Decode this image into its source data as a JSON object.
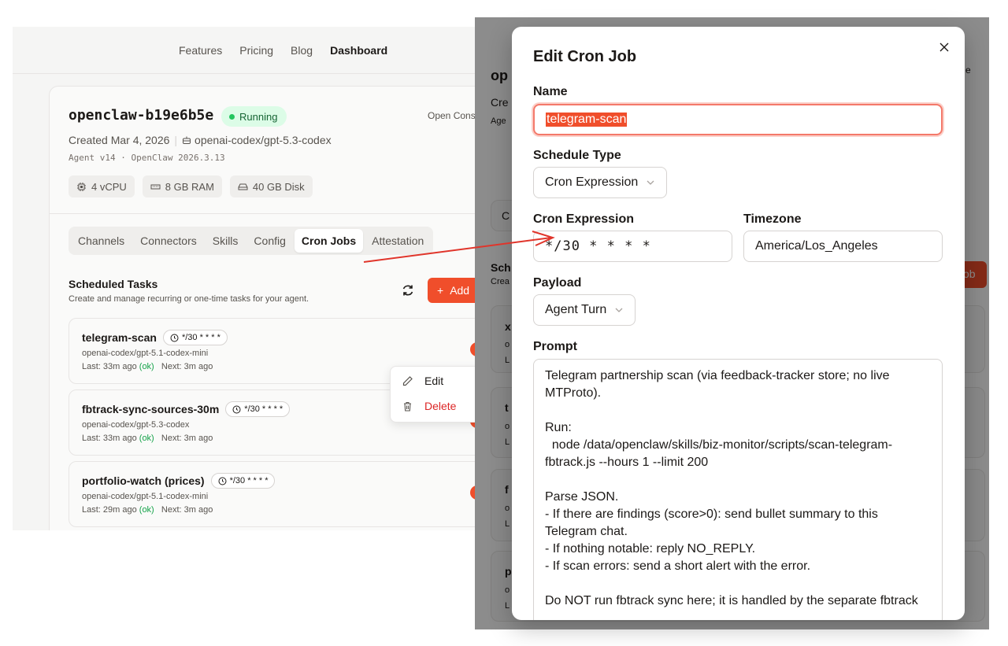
{
  "left": {
    "nav": [
      "Features",
      "Pricing",
      "Blog",
      "Dashboard"
    ],
    "nav_active_index": 3,
    "agent": {
      "name": "openclaw-b19e6b5e",
      "status": "Running",
      "open_console": "Open Cons",
      "created": "Created Mar 4, 2026",
      "model": "openai-codex/gpt-5.3-codex",
      "version": "Agent v14 · OpenClaw 2026.3.13",
      "specs": [
        "4 vCPU",
        "8 GB RAM",
        "40 GB Disk"
      ]
    },
    "tabs": [
      "Channels",
      "Connectors",
      "Skills",
      "Config",
      "Cron Jobs",
      "Attestation"
    ],
    "active_tab_index": 4,
    "scheduled": {
      "title": "Scheduled Tasks",
      "subtitle": "Create and manage recurring or one-time tasks for your agent.",
      "add_label": "Add"
    },
    "jobs": [
      {
        "name": "telegram-scan",
        "schedule": "*/30 * * * *",
        "model": "openai-codex/gpt-5.1-codex-mini",
        "last": "Last: 33m ago",
        "ok": "(ok)",
        "next": "Next: 3m ago",
        "enabled": true
      },
      {
        "name": "fbtrack-sync-sources-30m",
        "schedule": "*/30 * * * *",
        "model": "openai-codex/gpt-5.3-codex",
        "last": "Last: 33m ago",
        "ok": "(ok)",
        "next": "Next: 3m ago",
        "enabled": true
      },
      {
        "name": "portfolio-watch (prices)",
        "schedule": "*/30 * * * *",
        "model": "openai-codex/gpt-5.1-codex-mini",
        "last": "Last: 29m ago",
        "ok": "(ok)",
        "next": "Next: 3m ago",
        "enabled": true
      }
    ],
    "context_menu": {
      "edit": "Edit",
      "delete": "Delete"
    }
  },
  "right_bg": {
    "frag_op": "op",
    "frag_cre": "Cre",
    "frag_age": "Age",
    "frag_e": "e",
    "frag_c": "C",
    "frag_sch": "Sch",
    "frag_crea": "Crea",
    "frag_ob": "ob",
    "frag_x": "x",
    "frag_t": "t",
    "frag_f": "f",
    "frag_p": "p",
    "frag_o": "o",
    "frag_l": "L"
  },
  "modal": {
    "title": "Edit Cron Job",
    "name_label": "Name",
    "name_value": "telegram-scan",
    "schedule_type_label": "Schedule Type",
    "schedule_type_value": "Cron Expression",
    "cron_label": "Cron Expression",
    "cron_value": "*/30 * * * *",
    "timezone_label": "Timezone",
    "timezone_value": "America/Los_Angeles",
    "payload_label": "Payload",
    "payload_value": "Agent Turn",
    "prompt_label": "Prompt",
    "prompt_value": "Telegram partnership scan (via feedback-tracker store; no live MTProto).\n\nRun:\n  node /data/openclaw/skills/biz-monitor/scripts/scan-telegram-fbtrack.js --hours 1 --limit 200\n\nParse JSON.\n- If there are findings (score>0): send bullet summary to this Telegram chat.\n- If nothing notable: reply NO_REPLY.\n- If scan errors: send a short alert with the error.\n\nDo NOT run fbtrack sync here; it is handled by the separate fbtrack"
  },
  "colors": {
    "accent": "#f04e2b",
    "running": "#22c55e",
    "ok": "#16a34a",
    "delete": "#dc2626",
    "arrow": "#e0352b"
  }
}
